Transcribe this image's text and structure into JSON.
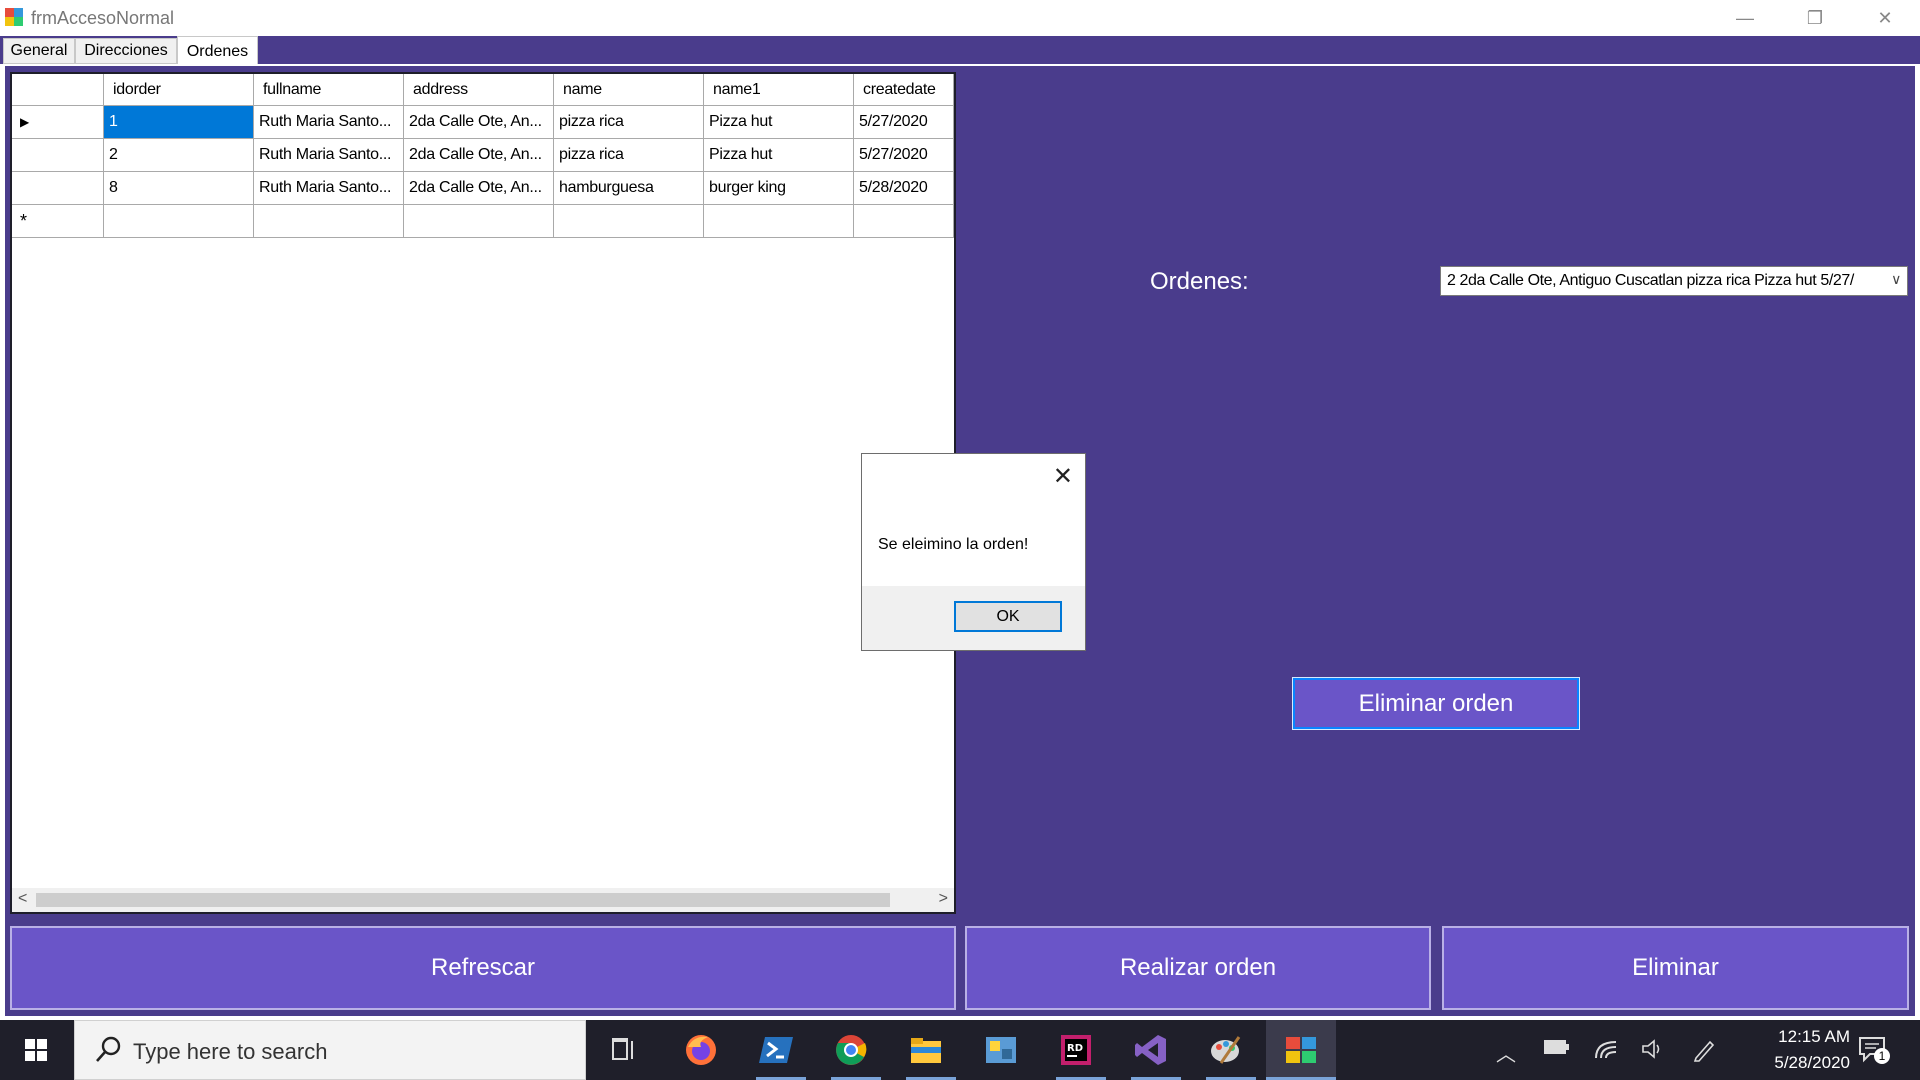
{
  "window": {
    "title": "frmAccesoNormal",
    "controls": {
      "minimize": "—",
      "restore": "❐",
      "close": "✕"
    }
  },
  "tabs": [
    {
      "label": "General",
      "active": false
    },
    {
      "label": "Direcciones",
      "active": false
    },
    {
      "label": "Ordenes",
      "active": true
    }
  ],
  "grid": {
    "columns": [
      "idorder",
      "fullname",
      "address",
      "name",
      "name1",
      "createdate"
    ],
    "rows": [
      {
        "marker": "▶",
        "cells": [
          "1",
          "Ruth Maria Santo...",
          "2da Calle Ote, An...",
          "pizza rica",
          "Pizza hut",
          "5/27/2020"
        ]
      },
      {
        "marker": "",
        "cells": [
          "2",
          "Ruth Maria Santo...",
          "2da Calle Ote, An...",
          "pizza rica",
          "Pizza hut",
          "5/27/2020"
        ]
      },
      {
        "marker": "",
        "cells": [
          "8",
          "Ruth Maria Santo...",
          "2da Calle Ote, An...",
          "hamburguesa",
          "burger king",
          "5/28/2020"
        ]
      }
    ],
    "new_row_marker": "*",
    "scroll_left": "<",
    "scroll_right": ">"
  },
  "ordenes": {
    "label": "Ordenes:",
    "selected": "2 2da Calle Ote, Antiguo Cuscatlan pizza rica Pizza hut 5/27/",
    "chevron": "∨"
  },
  "buttons": {
    "eliminar_orden": "Eliminar orden",
    "refrescar": "Refrescar",
    "realizar_orden": "Realizar orden",
    "eliminar": "Eliminar"
  },
  "dialog": {
    "message": "Se eleimino la orden!",
    "ok": "OK",
    "close": "✕"
  },
  "taskbar": {
    "search_placeholder": "Type here to search",
    "time": "12:15 AM",
    "date": "5/28/2020",
    "notification_count": "1",
    "colors": {
      "taskbar_bg": "#1f1f2a",
      "accent": "#6a55c8",
      "panel": "#4a3c8c"
    }
  }
}
